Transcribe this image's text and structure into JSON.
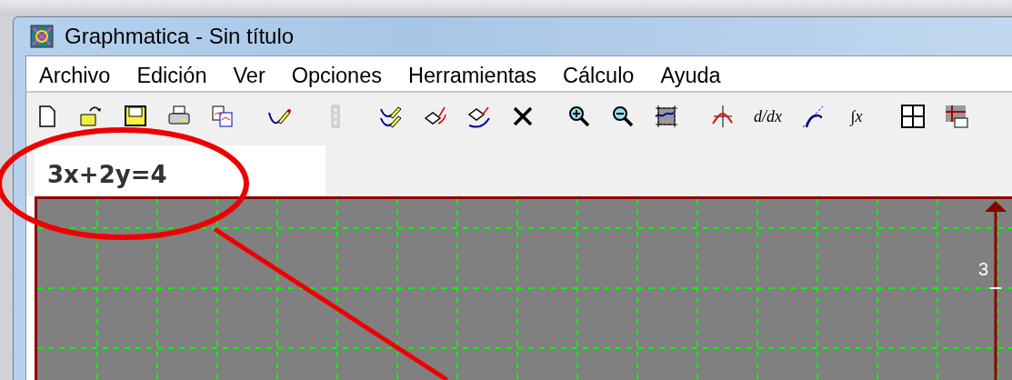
{
  "window": {
    "title": "Graphmatica - Sin título"
  },
  "menu": [
    {
      "label": "Archivo"
    },
    {
      "label": "Edición"
    },
    {
      "label": "Ver"
    },
    {
      "label": "Opciones"
    },
    {
      "label": "Herramientas"
    },
    {
      "label": "Cálculo"
    },
    {
      "label": "Ayuda"
    }
  ],
  "toolbar": [
    [
      {
        "kind": "new"
      },
      {
        "kind": "open"
      },
      {
        "kind": "save"
      },
      {
        "kind": "print"
      },
      {
        "kind": "copy"
      }
    ],
    [
      {
        "kind": "pencil"
      }
    ],
    [
      {
        "kind": "grip",
        "disabled": true
      }
    ],
    [
      {
        "kind": "pencils"
      },
      {
        "kind": "eraser"
      },
      {
        "kind": "eraser2"
      },
      {
        "kind": "delete"
      }
    ],
    [
      {
        "kind": "zoomin"
      },
      {
        "kind": "zoomout"
      },
      {
        "kind": "fit"
      }
    ],
    [
      {
        "kind": "roots"
      },
      {
        "kind": "derivative",
        "text": "d/dx"
      },
      {
        "kind": "tangent"
      },
      {
        "kind": "integral",
        "text": "∫x"
      }
    ],
    [
      {
        "kind": "table"
      },
      {
        "kind": "gridxy"
      }
    ]
  ],
  "equation": {
    "value": "3x+2y=4"
  },
  "graph": {
    "y_tick_label": "3"
  }
}
